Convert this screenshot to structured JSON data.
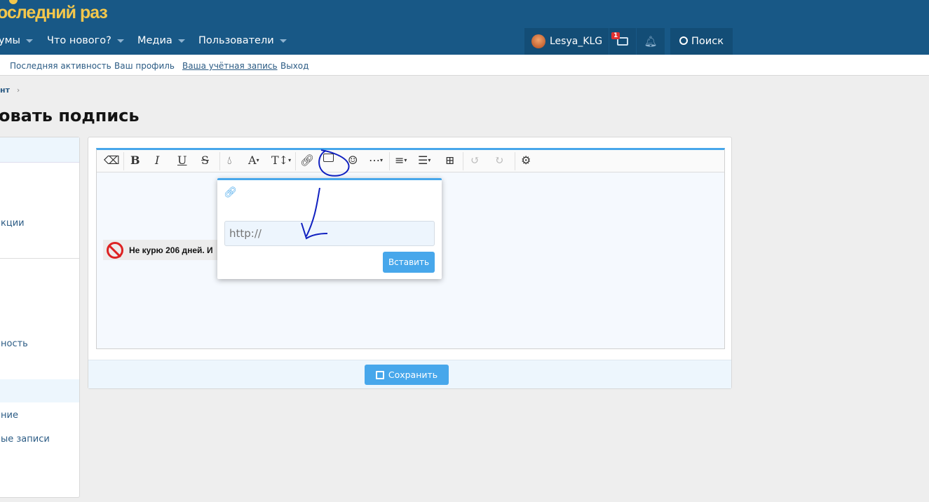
{
  "header": {
    "logo": "оследний раз",
    "nav": [
      {
        "label": "умы"
      },
      {
        "label": "Что нового?"
      },
      {
        "label": "Медиа"
      },
      {
        "label": "Пользователи"
      }
    ],
    "user": "Lesya_KLG",
    "inbox_badge": "1",
    "search": "Поиск"
  },
  "subnav": [
    "Последняя активность",
    "Ваш профиль",
    "Ваша учётная запись",
    "Выход"
  ],
  "breadcrumb": "нт",
  "page_title": "овать подпись",
  "sidebar": [
    "кции",
    "ность",
    "ние",
    "ые записи"
  ],
  "editor": {
    "signature_text": "Не курю 206 дней. И",
    "toolbar": [
      "eraser-icon",
      "bold-icon",
      "italic-icon",
      "underline-icon",
      "strikethrough-icon",
      "color-icon",
      "font-family-icon",
      "font-size-icon",
      "link-icon",
      "image-icon",
      "smiley-icon",
      "more-icon",
      "align-icon",
      "list-icon",
      "table-icon",
      "undo-icon",
      "redo-icon",
      "settings-icon"
    ]
  },
  "popup": {
    "placeholder": "http://",
    "insert": "Вставить"
  },
  "save": "Сохранить",
  "colors": {
    "header": "#185886",
    "accent": "#47a7eb",
    "logo": "#f3c74c",
    "link": "#2b5b84",
    "annotation": "#1020c0"
  }
}
